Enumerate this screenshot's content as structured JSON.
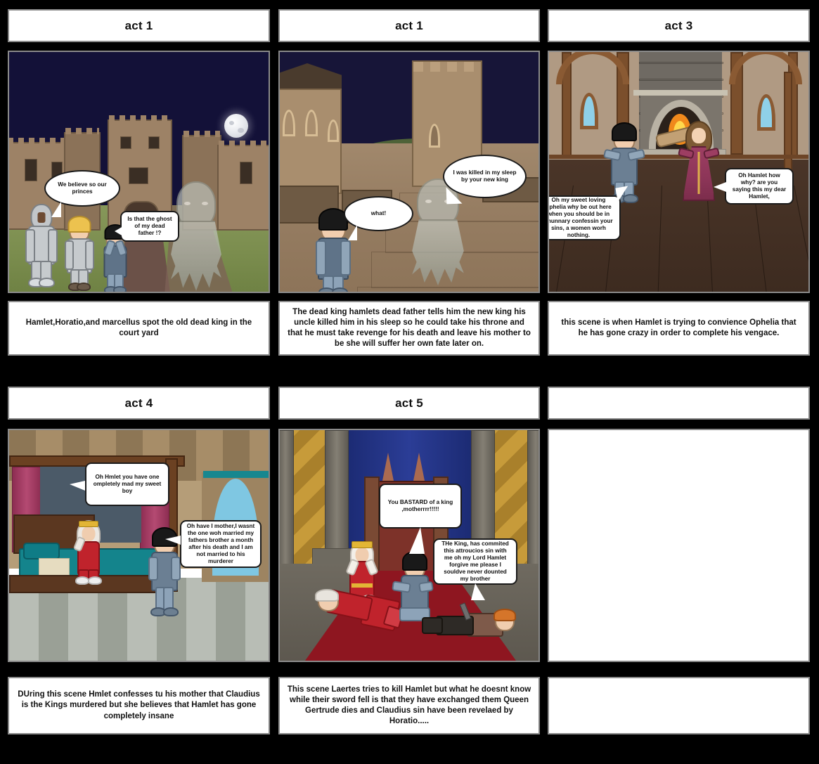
{
  "storyboard": {
    "title_bar_font_color": "#111111",
    "panel_border_color": "#8a8a8a",
    "background_color": "#000000",
    "cells": [
      {
        "id": "cell-1",
        "title": "act 1",
        "scene": "night-castle-courtyard",
        "caption": "Hamlet,Horatio,and marcellus spot the old dead king in the court yard",
        "bubbles": [
          {
            "text": "We believe so our princes"
          },
          {
            "text": "Is that the ghost of my dead father !?"
          }
        ]
      },
      {
        "id": "cell-2",
        "title": "act 1",
        "scene": "castle-battlement-night",
        "caption": "The dead king hamlets dead father tells him the new king his uncle killed him in his sleep so he could take his throne and that he must take revenge for his death and leave his mother to be she will suffer her own fate later on.",
        "bubbles": [
          {
            "text": "what!"
          },
          {
            "text": "I was killed in my sleep by your new king"
          }
        ]
      },
      {
        "id": "cell-3",
        "title": "act 3",
        "scene": "great-hall-fireplace",
        "caption": "this scene is when Hamlet is trying to convience Ophelia that he has gone crazy in order to complete his vengace.",
        "bubbles": [
          {
            "text": "Oh my sweet loving ophelia why be out here when you should be in anunnary confessin your sins, a women worh nothing."
          },
          {
            "text": "Oh Hamlet how why? are you saying this my dear Hamlet,"
          }
        ]
      },
      {
        "id": "cell-4",
        "title": "act 4",
        "scene": "royal-bedroom",
        "caption": "DUring this scene Hmlet confesses tu his mother that Claudius is the Kings murdered but she believes that Hamlet has gone completely insane",
        "bubbles": [
          {
            "text": "Oh Hmlet you have one ompletely mad my sweet boy"
          },
          {
            "text": "Oh have I mother,I wasnt the one woh married my fathers brother a month after his death and I am not married to his murderer"
          }
        ]
      },
      {
        "id": "cell-5",
        "title": "act 5",
        "scene": "throne-room-deaths",
        "caption": "This scene Laertes tries to kill Hamlet but what he doesnt know while their sword fell is that they have exchanged them Queen Gertrude dies and Claudius sin have been revelaed by Horatio.....",
        "bubbles": [
          {
            "text": "You BASTARD of a king ,motherrrr!!!!!"
          },
          {
            "text": "THe King, has commited this attroucios sin with me oh my Lord Hamlet forgive me please  I souldve never dounted my brother"
          }
        ]
      },
      {
        "id": "cell-6",
        "title": "",
        "scene": "blank",
        "caption": "",
        "bubbles": []
      }
    ]
  }
}
